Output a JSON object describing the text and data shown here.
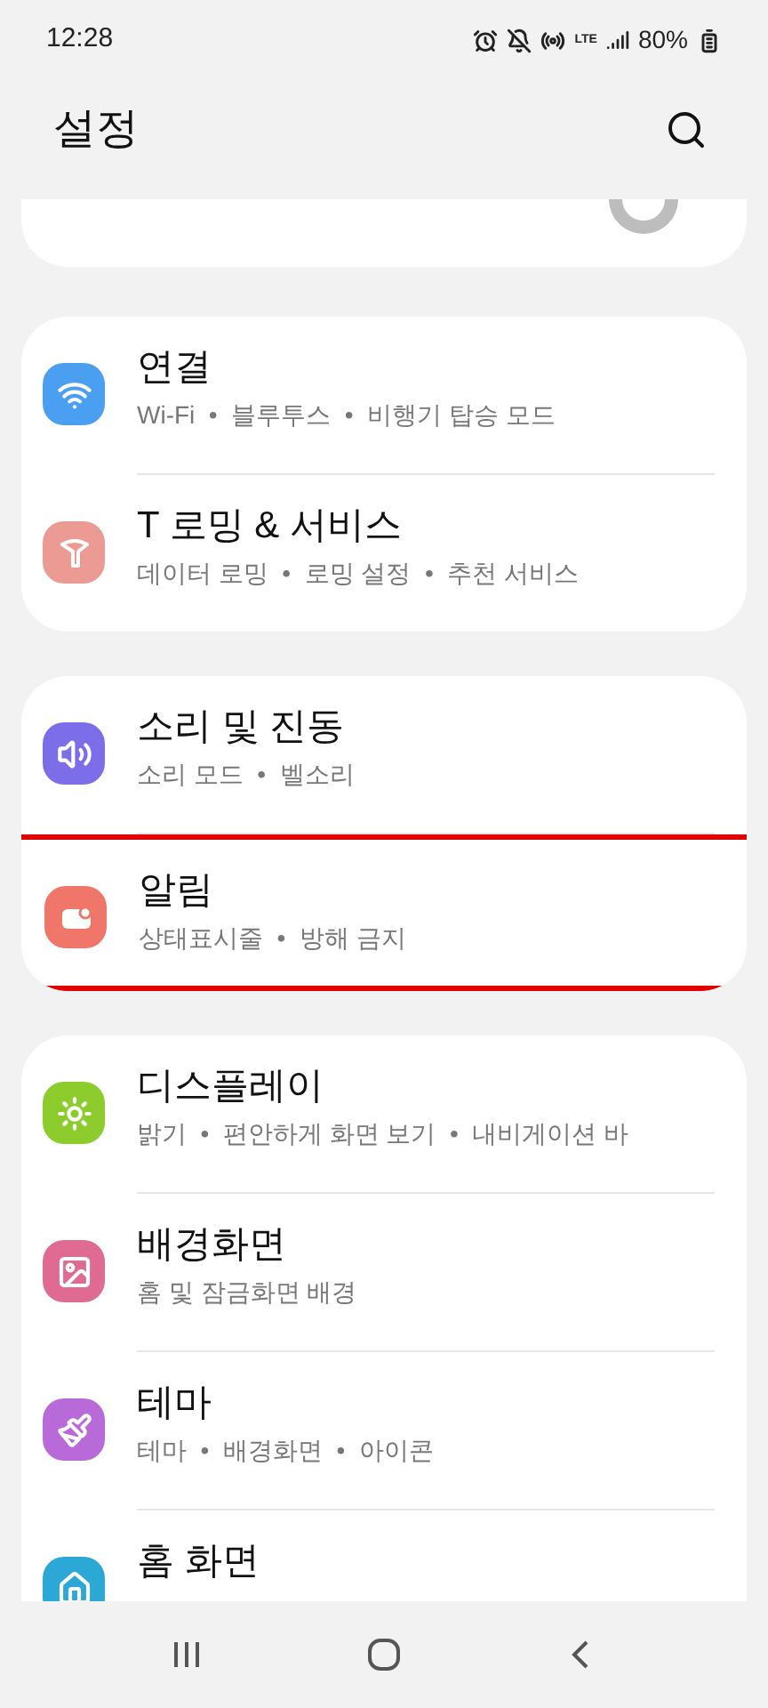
{
  "status_bar": {
    "time": "12:28",
    "network": "LTE",
    "battery": "80%"
  },
  "header": {
    "title": "설정"
  },
  "groups": [
    {
      "items": [
        {
          "kind": "wifi",
          "title": "연결",
          "subtitle": "Wi-Fi  •  블루투스  •  비행기 탑승 모드",
          "color": "#4a9ff0",
          "highlighted": false
        },
        {
          "kind": "roaming",
          "title": "T 로밍 & 서비스",
          "subtitle": "데이터 로밍  •  로밍 설정  •  추천 서비스",
          "color": "#ec9a94",
          "highlighted": false
        }
      ]
    },
    {
      "items": [
        {
          "kind": "sound",
          "title": "소리 및 진동",
          "subtitle": "소리 모드  •  벨소리",
          "color": "#7b6ee8",
          "highlighted": false
        },
        {
          "kind": "notification",
          "title": "알림",
          "subtitle": "상태표시줄  •  방해 금지",
          "color": "#ef7668",
          "highlighted": true
        }
      ]
    },
    {
      "items": [
        {
          "kind": "display",
          "title": "디스플레이",
          "subtitle": "밝기  •  편안하게 화면 보기  •  내비게이션 바",
          "color": "#8ccc2c",
          "highlighted": false
        },
        {
          "kind": "wallpaper",
          "title": "배경화면",
          "subtitle": "홈 및 잠금화면 배경",
          "color": "#e06b92",
          "highlighted": false
        },
        {
          "kind": "theme",
          "title": "테마",
          "subtitle": "테마  •  배경화면  •  아이콘",
          "color": "#b96ad9",
          "highlighted": false
        },
        {
          "kind": "home",
          "title": "홈 화면",
          "color": "#2ba8d6",
          "highlighted": false
        }
      ]
    }
  ]
}
